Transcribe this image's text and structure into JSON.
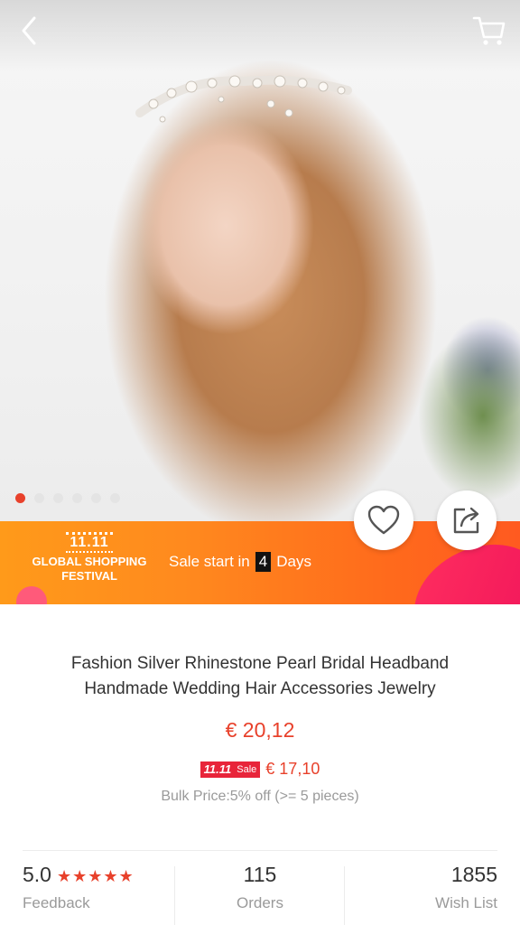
{
  "nav": {
    "back_icon": "chevron-left-icon",
    "cart_icon": "cart-icon"
  },
  "gallery": {
    "image_count": 6,
    "active_index": 0
  },
  "actions": {
    "wishlist_icon": "heart-icon",
    "share_icon": "share-icon"
  },
  "promo": {
    "festival_mark": "11.11",
    "festival_line1": "GLOBAL SHOPPING",
    "festival_line2": "FESTIVAL",
    "sale_prefix": "Sale start in",
    "days_count": "4",
    "days_label": "Days"
  },
  "product": {
    "title_line1": "Fashion Silver Rhinestone Pearl Bridal Headband",
    "title_line2": "Handmade Wedding Hair Accessories Jewelry",
    "price": "€ 20,12",
    "sale_badge_mark": "11.11",
    "sale_badge_label": "Sale",
    "sale_price": "€ 17,10",
    "bulk_price": "Bulk Price:5% off (>= 5 pieces)"
  },
  "stats": {
    "rating": "5.0",
    "stars": "★★★★★",
    "feedback_label": "Feedback",
    "orders": "115",
    "orders_label": "Orders",
    "wishlist": "1855",
    "wishlist_label": "Wish List"
  },
  "colors": {
    "accent": "#e8412b",
    "banner_orange": "#ff8a1e",
    "banner_pink": "#f0145a"
  }
}
